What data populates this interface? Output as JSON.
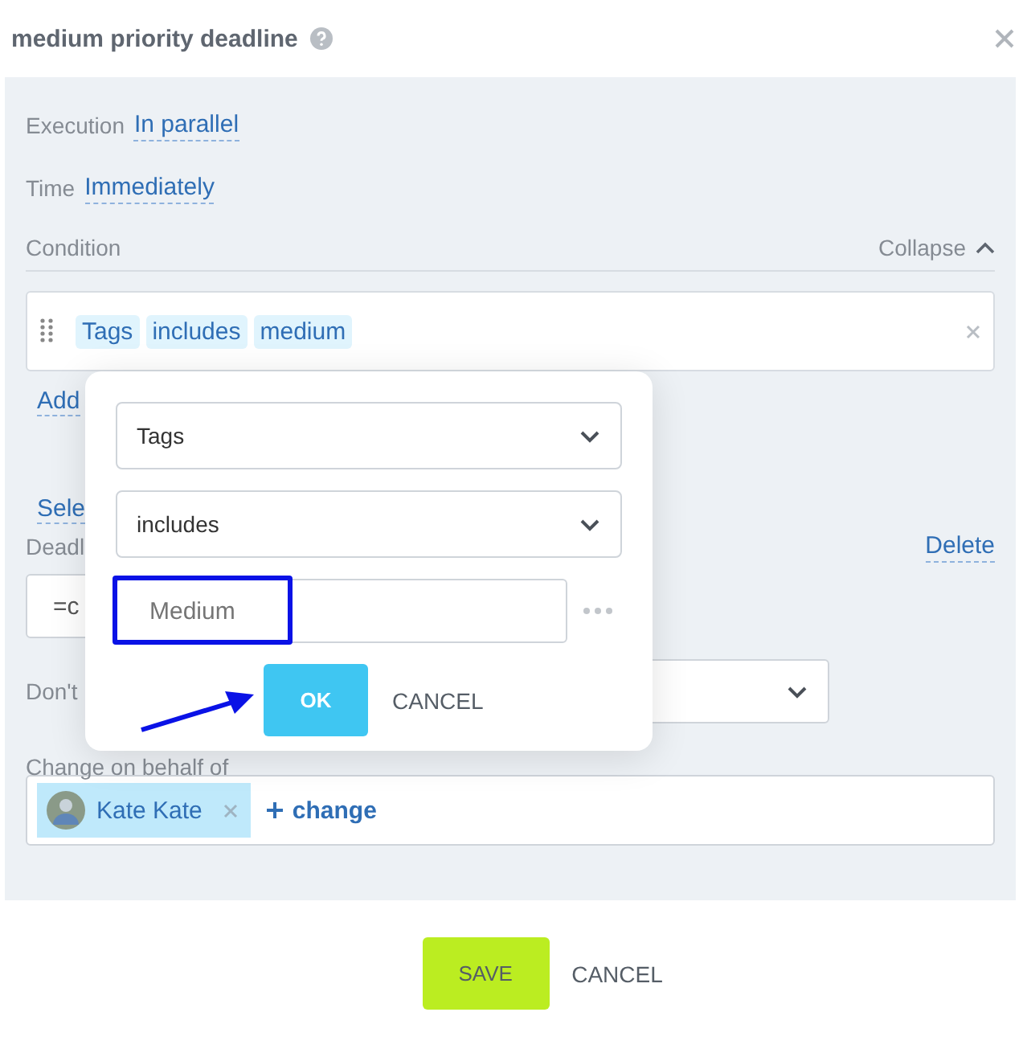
{
  "dialog": {
    "title": "medium priority deadline"
  },
  "execution": {
    "label": "Execution",
    "value": "In parallel"
  },
  "time": {
    "label": "Time",
    "value": "Immediately"
  },
  "condition": {
    "label": "Condition",
    "collapse": "Collapse",
    "tokens": [
      "Tags",
      "includes",
      "medium"
    ]
  },
  "add_link": "Add",
  "select_link": "Sele",
  "deadline": {
    "label": "Deadl",
    "delete": "Delete",
    "value": "=c"
  },
  "dont": {
    "label": "Don't"
  },
  "behalf": {
    "label": "Change on behalf of",
    "person": "Kate Kate",
    "change": "change"
  },
  "popup": {
    "field": "Tags",
    "operator": "includes",
    "placeholder": "Medium",
    "ok": "OK",
    "cancel": "CANCEL"
  },
  "buttons": {
    "save": "SAVE",
    "cancel": "CANCEL"
  }
}
